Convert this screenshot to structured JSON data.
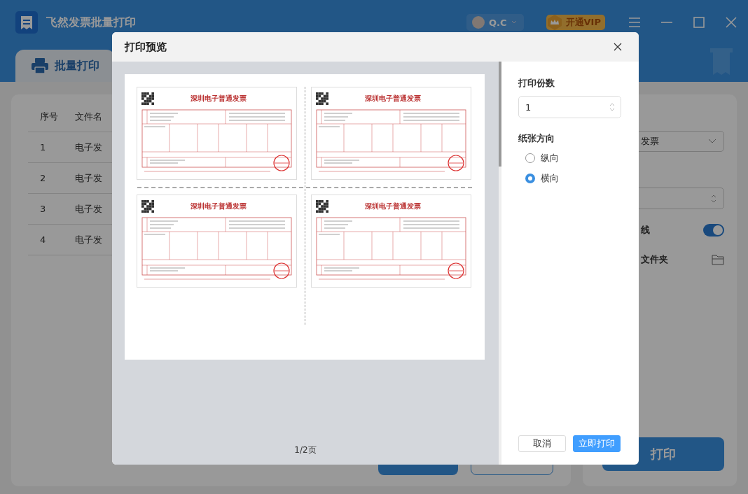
{
  "app": {
    "title": "飞然发票批量打印",
    "user": {
      "name": "Q.C"
    },
    "vip_button": "开通VIP",
    "tabs": [
      {
        "label": "批量打印",
        "selected": true
      }
    ]
  },
  "file_table": {
    "columns": [
      "序号",
      "文件名"
    ],
    "rows": [
      [
        "1",
        "电子发"
      ],
      [
        "2",
        "电子发"
      ],
      [
        "3",
        "电子发"
      ],
      [
        "4",
        "电子发"
      ]
    ]
  },
  "settings_panel": {
    "dropdown_value": "发票",
    "toggle": {
      "label": "线",
      "on": true
    },
    "folder_label": "文件夹",
    "print_button": "打印"
  },
  "dialog": {
    "title": "打印预览",
    "preview": {
      "invoices": [
        {
          "title": "深圳电子普通发票"
        },
        {
          "title": "深圳电子普通发票"
        },
        {
          "title": "深圳电子普通发票"
        },
        {
          "title": "深圳电子普通发票"
        }
      ],
      "page_indicator": "1/2页"
    },
    "copies": {
      "label": "打印份数",
      "value": "1"
    },
    "orientation": {
      "label": "纸张方向",
      "options": [
        {
          "label": "纵向",
          "selected": false
        },
        {
          "label": "横向",
          "selected": true
        }
      ]
    },
    "buttons": [
      {
        "label": "取消",
        "kind": "secondary"
      },
      {
        "label": "立即打印",
        "kind": "primary"
      }
    ]
  }
}
